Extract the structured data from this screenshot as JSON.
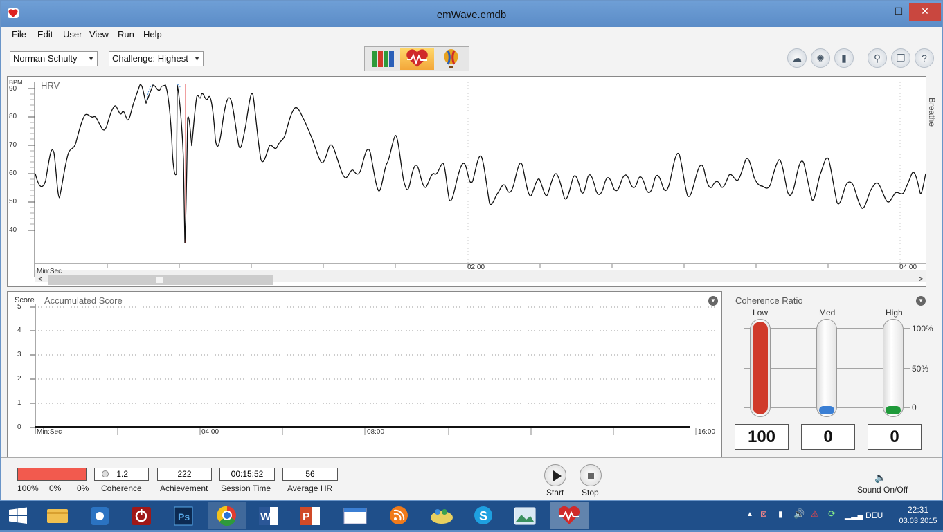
{
  "window": {
    "title": "emWave.emdb",
    "minimize": "—",
    "maximize": "☐",
    "close": "✕"
  },
  "menu": [
    "File",
    "Edit",
    "User",
    "View",
    "Run",
    "Help"
  ],
  "toolbar": {
    "user": "Norman Schulty",
    "challenge": "Challenge: Highest"
  },
  "hrv": {
    "title": "HRV",
    "unit": "BPM",
    "yticks": [
      "90",
      "80",
      "70",
      "60",
      "50",
      "40"
    ],
    "xlabel": "Min:Sec",
    "xticks": [
      "02:00",
      "04:00"
    ],
    "side_label": "Breathe"
  },
  "score": {
    "title": "Accumulated Score",
    "unit": "Score",
    "yticks": [
      "5",
      "4",
      "3",
      "2",
      "1",
      "0"
    ],
    "xlabel": "Min:Sec",
    "xticks": [
      "04:00",
      "08:00",
      "16:00"
    ]
  },
  "coherence": {
    "title": "Coherence Ratio",
    "columns": [
      "Low",
      "Med",
      "High"
    ],
    "scale": [
      "100%",
      "50%",
      "0"
    ],
    "values": [
      "100",
      "0",
      "0"
    ],
    "fill_fraction": [
      1.0,
      0.0,
      0.0
    ],
    "colors": [
      "#d03a2a",
      "#3b7fd4",
      "#1f9a3a"
    ]
  },
  "status": {
    "pct_low": "100%",
    "pct_med": "0%",
    "pct_high": "0%",
    "coherence_value": "1.2",
    "coherence_label": "Coherence",
    "achievement_value": "222",
    "achievement_label": "Achievement",
    "session_value": "00:15:52",
    "session_label": "Session Time",
    "hr_value": "56",
    "hr_label": "Average HR",
    "start": "Start",
    "stop": "Stop",
    "sound": "Sound On/Off"
  },
  "tray": {
    "lang": "DEU",
    "time": "22:31",
    "date": "03.03.2015"
  }
}
